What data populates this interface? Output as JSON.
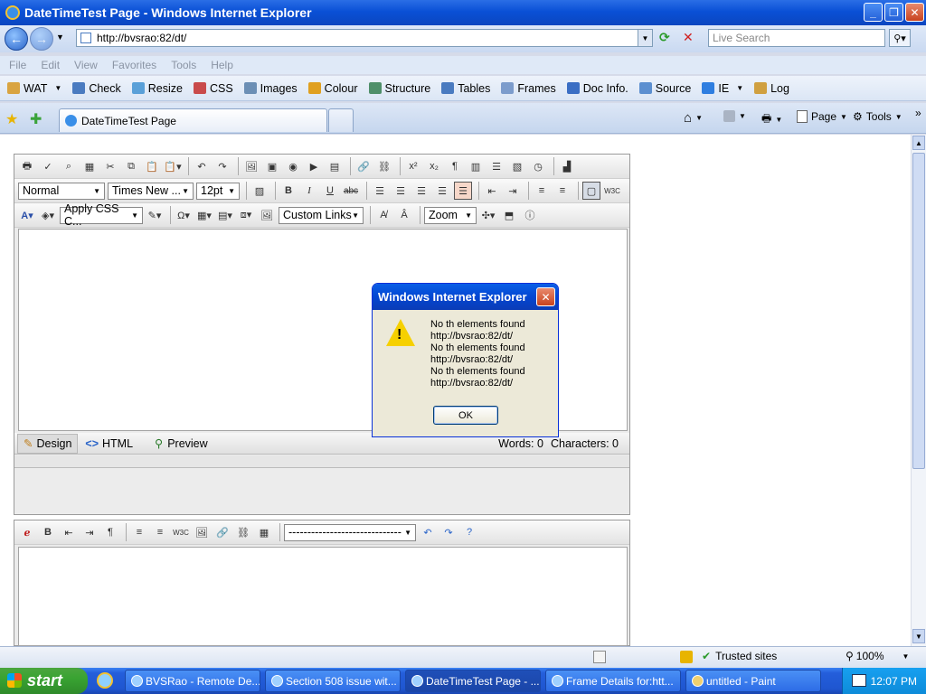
{
  "window": {
    "title": "DateTimeTest Page - Windows Internet Explorer"
  },
  "address": {
    "url": "http://bvsrao:82/dt/",
    "search_placeholder": "Live Search"
  },
  "menu": [
    "File",
    "Edit",
    "View",
    "Favorites",
    "Tools",
    "Help"
  ],
  "wat_toolbar": [
    {
      "label": "WAT",
      "icon": "wat-icon",
      "color": "#d9a441"
    },
    {
      "label": "Check",
      "icon": "check-icon",
      "color": "#4a7bc0"
    },
    {
      "label": "Resize",
      "icon": "resize-icon",
      "color": "#5aa0d8"
    },
    {
      "label": "CSS",
      "icon": "css-icon",
      "color": "#c94b4b"
    },
    {
      "label": "Images",
      "icon": "images-icon",
      "color": "#6c8fb5"
    },
    {
      "label": "Colour",
      "icon": "colour-icon",
      "color": "#e0a020"
    },
    {
      "label": "Structure",
      "icon": "structure-icon",
      "color": "#4f8f6a"
    },
    {
      "label": "Tables",
      "icon": "tables-icon",
      "color": "#4a7bc0"
    },
    {
      "label": "Frames",
      "icon": "frames-icon",
      "color": "#7c9ccc"
    },
    {
      "label": "Doc Info.",
      "icon": "info-icon",
      "color": "#3a6ec4"
    },
    {
      "label": "Source",
      "icon": "source-icon",
      "color": "#5c8fd0"
    },
    {
      "label": "IE",
      "icon": "ie-icon",
      "color": "#2f7ee0"
    },
    {
      "label": "Log",
      "icon": "log-icon",
      "color": "#d0a040"
    }
  ],
  "tabs": {
    "active": "DateTimeTest Page"
  },
  "right_tools": {
    "page": "Page",
    "tools": "Tools"
  },
  "editor": {
    "format": "Normal",
    "font": "Times New ...",
    "size": "12pt",
    "css": "Apply CSS C...",
    "links": "Custom Links",
    "zoom": "Zoom",
    "modes": {
      "design": "Design",
      "html": "HTML",
      "preview": "Preview"
    },
    "words": "Words: 0",
    "characters": "Characters: 0"
  },
  "editor2": {
    "dropdown": "------------------------------"
  },
  "dialog": {
    "title": "Windows Internet Explorer",
    "message": "No th elements found\nhttp://bvsrao:82/dt/\nNo th elements found\nhttp://bvsrao:82/dt/\nNo th elements found\nhttp://bvsrao:82/dt/",
    "ok": "OK"
  },
  "status": {
    "zone": "Trusted sites",
    "zoom": "100%"
  },
  "taskbar": {
    "start": "start",
    "items": [
      "BVSRao - Remote De...",
      "Section 508 issue wit...",
      "DateTimeTest Page - ...",
      "Frame Details for:htt...",
      "untitled - Paint"
    ],
    "clock": "12:07 PM"
  }
}
